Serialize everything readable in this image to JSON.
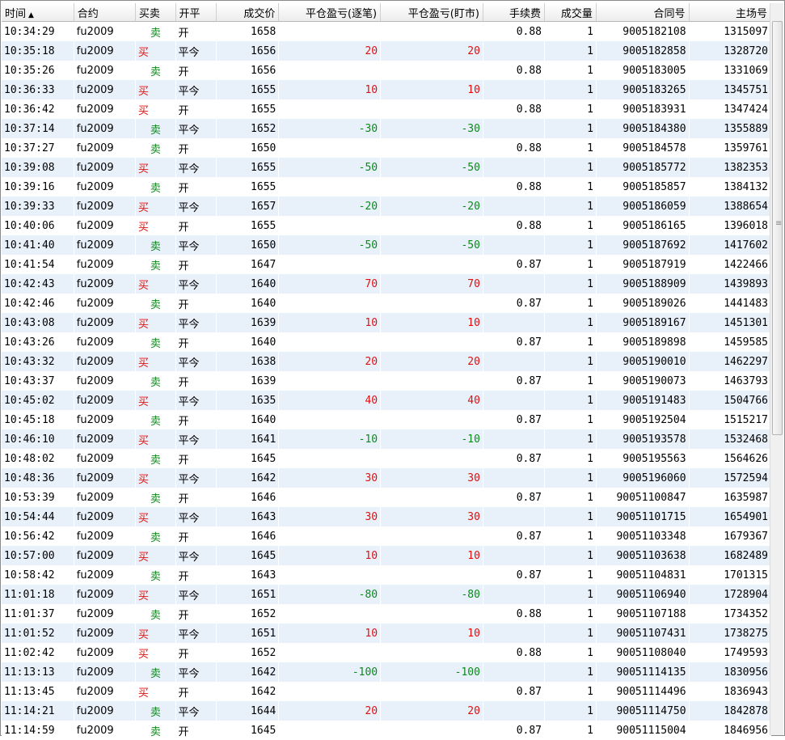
{
  "columns": [
    {
      "label": "时间",
      "sort": "▲"
    },
    {
      "label": "合约"
    },
    {
      "label": "买卖"
    },
    {
      "label": "开平"
    },
    {
      "label": "成交价"
    },
    {
      "label": "平仓盈亏(逐笔)"
    },
    {
      "label": "平仓盈亏(盯市)"
    },
    {
      "label": "手续费"
    },
    {
      "label": "成交量"
    },
    {
      "label": "合同号"
    },
    {
      "label": "主场号"
    }
  ],
  "colors": {
    "buy": "#e01010",
    "sell": "#0a8a1a",
    "profit": "#e01010",
    "loss": "#0a8a1a"
  },
  "rows": [
    [
      "10:34:29",
      "fu2009",
      "卖",
      "开",
      "1658",
      "",
      "",
      "0.88",
      "1",
      "9005182108",
      "1315097"
    ],
    [
      "10:35:18",
      "fu2009",
      "买",
      "平今",
      "1656",
      "20",
      "20",
      "",
      "1",
      "9005182858",
      "1328720"
    ],
    [
      "10:35:26",
      "fu2009",
      "卖",
      "开",
      "1656",
      "",
      "",
      "0.88",
      "1",
      "9005183005",
      "1331069"
    ],
    [
      "10:36:33",
      "fu2009",
      "买",
      "平今",
      "1655",
      "10",
      "10",
      "",
      "1",
      "9005183265",
      "1345751"
    ],
    [
      "10:36:42",
      "fu2009",
      "买",
      "开",
      "1655",
      "",
      "",
      "0.88",
      "1",
      "9005183931",
      "1347424"
    ],
    [
      "10:37:14",
      "fu2009",
      "卖",
      "平今",
      "1652",
      "-30",
      "-30",
      "",
      "1",
      "9005184380",
      "1355889"
    ],
    [
      "10:37:27",
      "fu2009",
      "卖",
      "开",
      "1650",
      "",
      "",
      "0.88",
      "1",
      "9005184578",
      "1359761"
    ],
    [
      "10:39:08",
      "fu2009",
      "买",
      "平今",
      "1655",
      "-50",
      "-50",
      "",
      "1",
      "9005185772",
      "1382353"
    ],
    [
      "10:39:16",
      "fu2009",
      "卖",
      "开",
      "1655",
      "",
      "",
      "0.88",
      "1",
      "9005185857",
      "1384132"
    ],
    [
      "10:39:33",
      "fu2009",
      "买",
      "平今",
      "1657",
      "-20",
      "-20",
      "",
      "1",
      "9005186059",
      "1388654"
    ],
    [
      "10:40:06",
      "fu2009",
      "买",
      "开",
      "1655",
      "",
      "",
      "0.88",
      "1",
      "9005186165",
      "1396018"
    ],
    [
      "10:41:40",
      "fu2009",
      "卖",
      "平今",
      "1650",
      "-50",
      "-50",
      "",
      "1",
      "9005187692",
      "1417602"
    ],
    [
      "10:41:54",
      "fu2009",
      "卖",
      "开",
      "1647",
      "",
      "",
      "0.87",
      "1",
      "9005187919",
      "1422466"
    ],
    [
      "10:42:43",
      "fu2009",
      "买",
      "平今",
      "1640",
      "70",
      "70",
      "",
      "1",
      "9005188909",
      "1439893"
    ],
    [
      "10:42:46",
      "fu2009",
      "卖",
      "开",
      "1640",
      "",
      "",
      "0.87",
      "1",
      "9005189026",
      "1441483"
    ],
    [
      "10:43:08",
      "fu2009",
      "买",
      "平今",
      "1639",
      "10",
      "10",
      "",
      "1",
      "9005189167",
      "1451301"
    ],
    [
      "10:43:26",
      "fu2009",
      "卖",
      "开",
      "1640",
      "",
      "",
      "0.87",
      "1",
      "9005189898",
      "1459585"
    ],
    [
      "10:43:32",
      "fu2009",
      "买",
      "平今",
      "1638",
      "20",
      "20",
      "",
      "1",
      "9005190010",
      "1462297"
    ],
    [
      "10:43:37",
      "fu2009",
      "卖",
      "开",
      "1639",
      "",
      "",
      "0.87",
      "1",
      "9005190073",
      "1463793"
    ],
    [
      "10:45:02",
      "fu2009",
      "买",
      "平今",
      "1635",
      "40",
      "40",
      "",
      "1",
      "9005191483",
      "1504766"
    ],
    [
      "10:45:18",
      "fu2009",
      "卖",
      "开",
      "1640",
      "",
      "",
      "0.87",
      "1",
      "9005192504",
      "1515217"
    ],
    [
      "10:46:10",
      "fu2009",
      "买",
      "平今",
      "1641",
      "-10",
      "-10",
      "",
      "1",
      "9005193578",
      "1532468"
    ],
    [
      "10:48:02",
      "fu2009",
      "卖",
      "开",
      "1645",
      "",
      "",
      "0.87",
      "1",
      "9005195563",
      "1564626"
    ],
    [
      "10:48:36",
      "fu2009",
      "买",
      "平今",
      "1642",
      "30",
      "30",
      "",
      "1",
      "9005196060",
      "1572594"
    ],
    [
      "10:53:39",
      "fu2009",
      "卖",
      "开",
      "1646",
      "",
      "",
      "0.87",
      "1",
      "90051100847",
      "1635987"
    ],
    [
      "10:54:44",
      "fu2009",
      "买",
      "平今",
      "1643",
      "30",
      "30",
      "",
      "1",
      "90051101715",
      "1654901"
    ],
    [
      "10:56:42",
      "fu2009",
      "卖",
      "开",
      "1646",
      "",
      "",
      "0.87",
      "1",
      "90051103348",
      "1679367"
    ],
    [
      "10:57:00",
      "fu2009",
      "买",
      "平今",
      "1645",
      "10",
      "10",
      "",
      "1",
      "90051103638",
      "1682489"
    ],
    [
      "10:58:42",
      "fu2009",
      "卖",
      "开",
      "1643",
      "",
      "",
      "0.87",
      "1",
      "90051104831",
      "1701315"
    ],
    [
      "11:01:18",
      "fu2009",
      "买",
      "平今",
      "1651",
      "-80",
      "-80",
      "",
      "1",
      "90051106940",
      "1728904"
    ],
    [
      "11:01:37",
      "fu2009",
      "卖",
      "开",
      "1652",
      "",
      "",
      "0.88",
      "1",
      "90051107188",
      "1734352"
    ],
    [
      "11:01:52",
      "fu2009",
      "买",
      "平今",
      "1651",
      "10",
      "10",
      "",
      "1",
      "90051107431",
      "1738275"
    ],
    [
      "11:02:42",
      "fu2009",
      "买",
      "开",
      "1652",
      "",
      "",
      "0.88",
      "1",
      "90051108040",
      "1749593"
    ],
    [
      "11:13:13",
      "fu2009",
      "卖",
      "平今",
      "1642",
      "-100",
      "-100",
      "",
      "1",
      "90051114135",
      "1830956"
    ],
    [
      "11:13:45",
      "fu2009",
      "买",
      "开",
      "1642",
      "",
      "",
      "0.87",
      "1",
      "90051114496",
      "1836943"
    ],
    [
      "11:14:21",
      "fu2009",
      "卖",
      "平今",
      "1644",
      "20",
      "20",
      "",
      "1",
      "90051114750",
      "1842878"
    ],
    [
      "11:14:59",
      "fu2009",
      "卖",
      "开",
      "1645",
      "",
      "",
      "0.87",
      "1",
      "90051115004",
      "1846956"
    ]
  ]
}
